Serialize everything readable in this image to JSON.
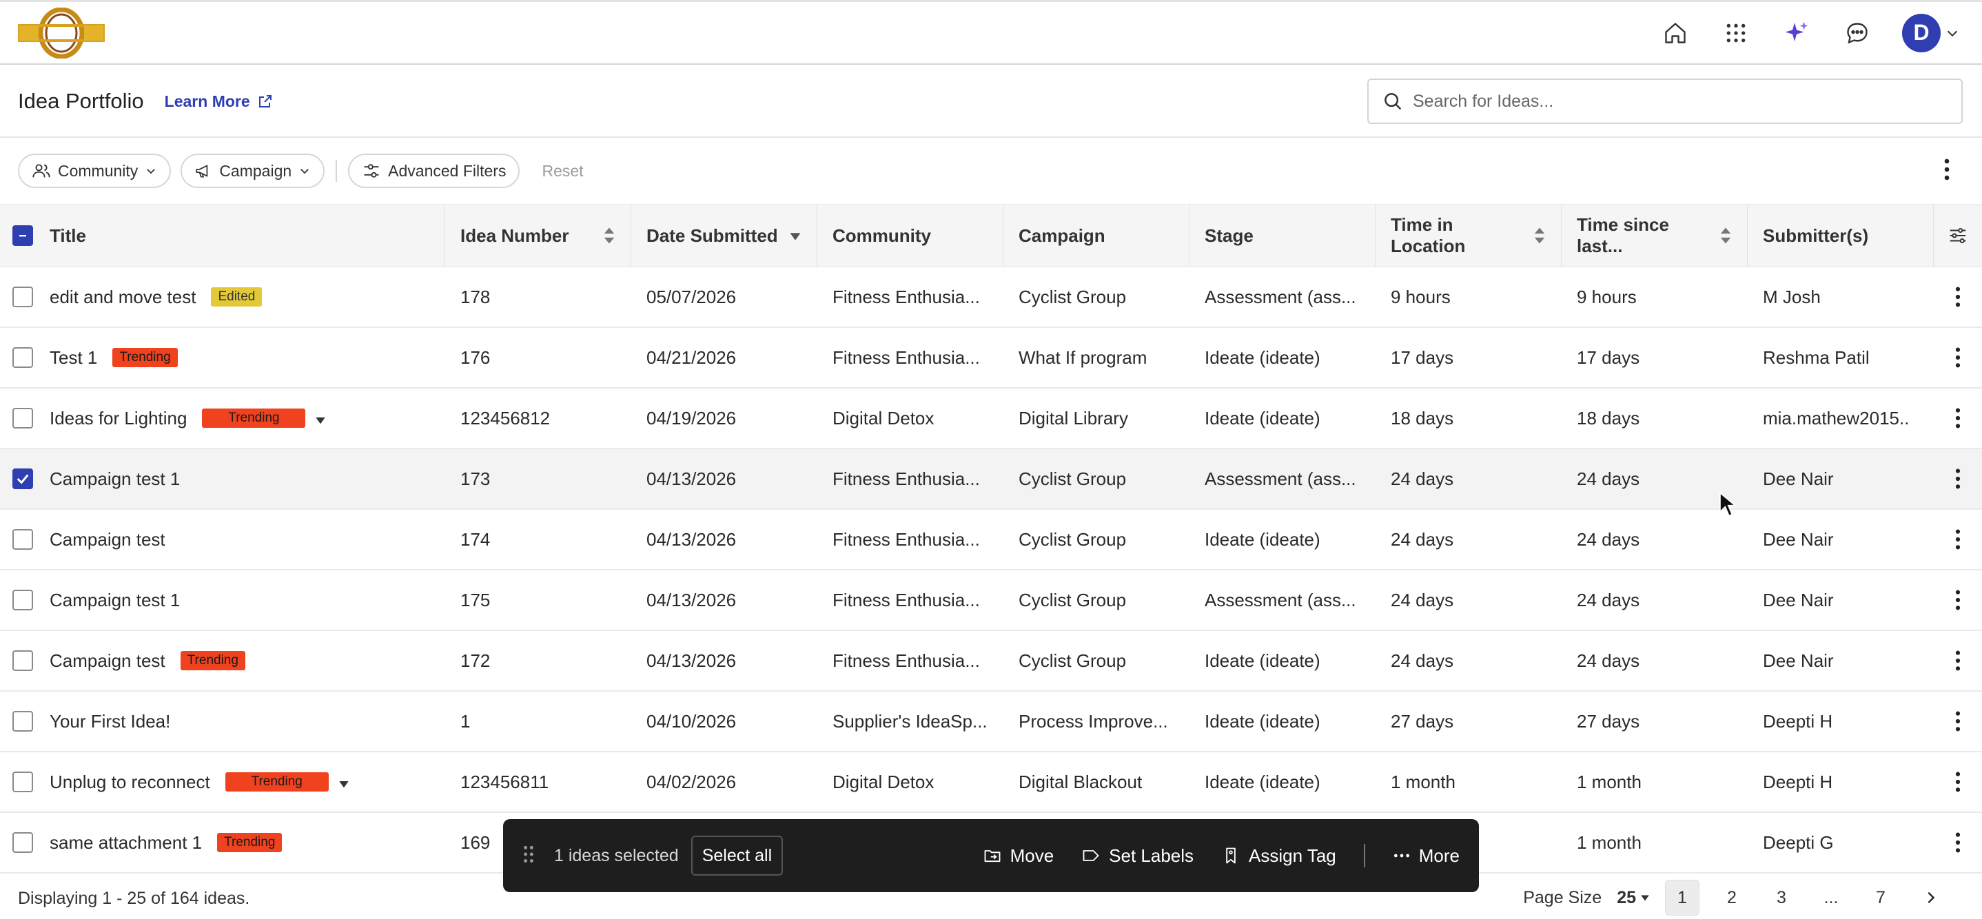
{
  "header": {
    "title": "Idea Portfolio",
    "learn_more": "Learn More",
    "avatar_initial": "D"
  },
  "search": {
    "placeholder": "Search for Ideas..."
  },
  "filters": {
    "community": "Community",
    "campaign": "Campaign",
    "advanced": "Advanced Filters",
    "reset": "Reset"
  },
  "columns": {
    "title": "Title",
    "idea_number": "Idea Number",
    "date_submitted": "Date Submitted",
    "community": "Community",
    "campaign": "Campaign",
    "stage": "Stage",
    "time_in_location": "Time in Location",
    "time_since_last": "Time since last...",
    "submitters": "Submitter(s)"
  },
  "rows": [
    {
      "title": "edit and move test",
      "badge": "Edited",
      "badge_type": "edited",
      "num": "178",
      "date": "05/07/2026",
      "community": "Fitness Enthusia...",
      "campaign": "Cyclist Group",
      "stage": "Assessment (ass...",
      "tloc": "9 hours",
      "tlast": "9 hours",
      "sub": "M Josh",
      "checked": false
    },
    {
      "title": "Test 1",
      "badge": "Trending",
      "badge_type": "trending",
      "num": "176",
      "date": "04/21/2026",
      "community": "Fitness Enthusia...",
      "campaign": "What If program",
      "stage": "Ideate (ideate)",
      "tloc": "17 days",
      "tlast": "17 days",
      "sub": "Reshma Patil",
      "checked": false
    },
    {
      "title": "Ideas for Lighting",
      "badge": "Trending",
      "badge_type": "trending",
      "num": "123456812",
      "date": "04/19/2026",
      "community": "Digital Detox",
      "campaign": "Digital Library",
      "stage": "Ideate (ideate)",
      "tloc": "18 days",
      "tlast": "18 days",
      "sub": "mia.mathew2015..",
      "checked": false
    },
    {
      "title": "Campaign test 1",
      "badge": "",
      "badge_type": "",
      "num": "173",
      "date": "04/13/2026",
      "community": "Fitness Enthusia...",
      "campaign": "Cyclist Group",
      "stage": "Assessment (ass...",
      "tloc": "24 days",
      "tlast": "24 days",
      "sub": "Dee Nair",
      "checked": true
    },
    {
      "title": "Campaign test",
      "badge": "",
      "badge_type": "",
      "num": "174",
      "date": "04/13/2026",
      "community": "Fitness Enthusia...",
      "campaign": "Cyclist Group",
      "stage": "Ideate (ideate)",
      "tloc": "24 days",
      "tlast": "24 days",
      "sub": "Dee Nair",
      "checked": false
    },
    {
      "title": "Campaign test 1",
      "badge": "",
      "badge_type": "",
      "num": "175",
      "date": "04/13/2026",
      "community": "Fitness Enthusia...",
      "campaign": "Cyclist Group",
      "stage": "Assessment (ass...",
      "tloc": "24 days",
      "tlast": "24 days",
      "sub": "Dee Nair",
      "checked": false
    },
    {
      "title": "Campaign test",
      "badge": "Trending",
      "badge_type": "trending",
      "num": "172",
      "date": "04/13/2026",
      "community": "Fitness Enthusia...",
      "campaign": "Cyclist Group",
      "stage": "Ideate (ideate)",
      "tloc": "24 days",
      "tlast": "24 days",
      "sub": "Dee Nair",
      "checked": false
    },
    {
      "title": "Your First Idea!",
      "badge": "",
      "badge_type": "",
      "num": "1",
      "date": "04/10/2026",
      "community": "Supplier's IdeaSp...",
      "campaign": "Process Improve...",
      "stage": "Ideate (ideate)",
      "tloc": "27 days",
      "tlast": "27 days",
      "sub": "Deepti H",
      "checked": false
    },
    {
      "title": "Unplug to reconnect",
      "badge": "Trending",
      "badge_type": "trending",
      "num": "123456811",
      "date": "04/02/2026",
      "community": "Digital Detox",
      "campaign": "Digital Blackout",
      "stage": "Ideate (ideate)",
      "tloc": "1 month",
      "tlast": "1 month",
      "sub": "Deepti H",
      "checked": false
    },
    {
      "title": "same attachment 1",
      "badge": "Trending",
      "badge_type": "trending",
      "num": "169",
      "date": "",
      "community": "",
      "campaign": "",
      "stage": "",
      "tloc": "",
      "tlast": "1 month",
      "sub": "Deepti G",
      "checked": false
    }
  ],
  "footer": {
    "displaying": "Displaying 1 - 25 of 164 ideas.",
    "page_size_label": "Page Size",
    "page_size": "25",
    "pages": [
      "1",
      "2",
      "3",
      "...",
      "7"
    ]
  },
  "action_bar": {
    "selected": "1 ideas selected",
    "select_all": "Select all",
    "move": "Move",
    "set_labels": "Set Labels",
    "assign_tag": "Assign Tag",
    "more": "More"
  },
  "colors": {
    "accent": "#2f3eb0",
    "trending": "#f0421f",
    "edited": "#e3c938",
    "action_bar": "#1e1e1e"
  }
}
